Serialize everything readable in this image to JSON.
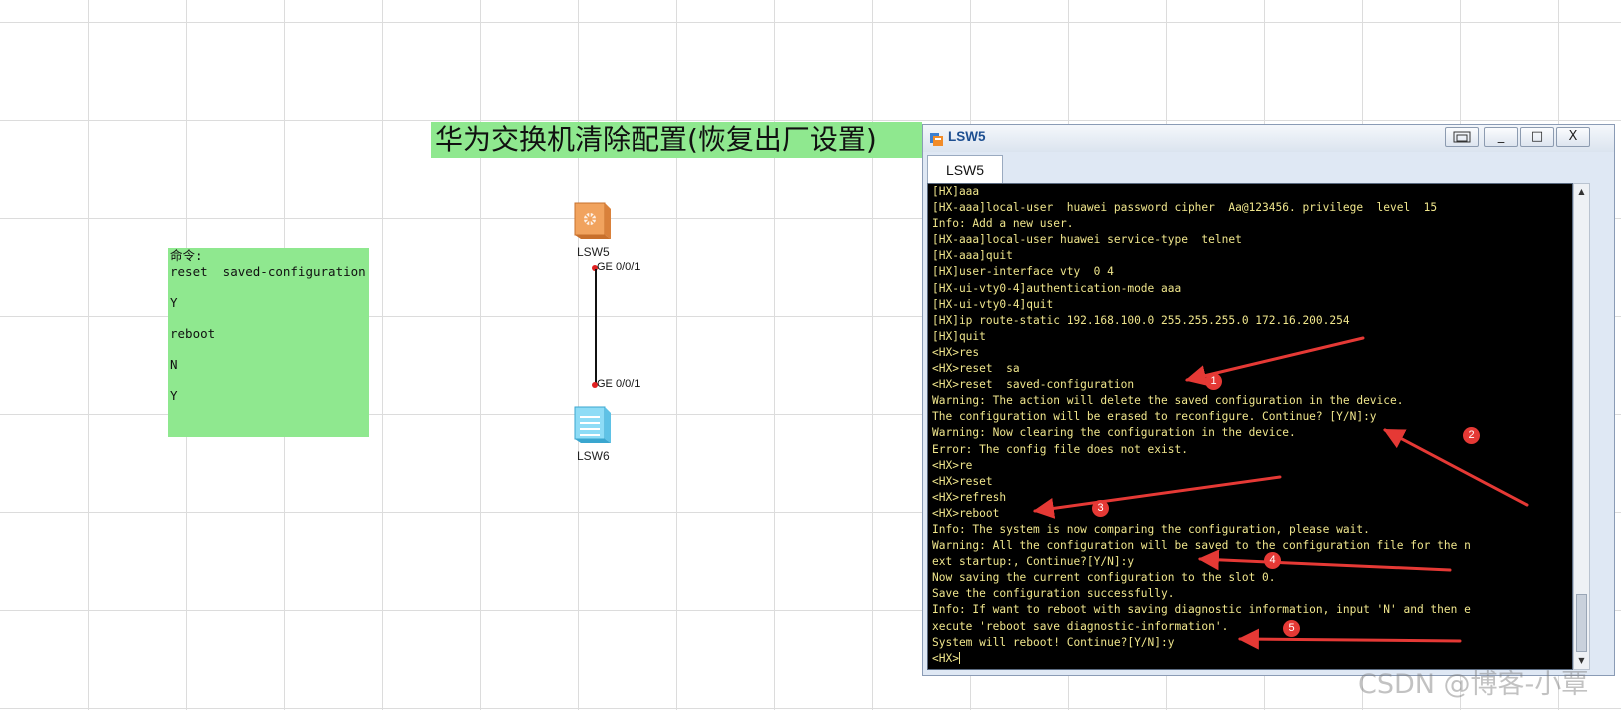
{
  "title_banner": "华为交换机清除配置(恢复出厂设置)",
  "notes": [
    "命令:",
    "reset  saved-configuration",
    "",
    "Y",
    "",
    "reboot",
    "",
    "N",
    "",
    "Y"
  ],
  "topology": {
    "device_top": {
      "label": "LSW5",
      "icon": "switch-orange-icon",
      "port": "GE 0/0/1"
    },
    "device_bottom": {
      "label": "LSW6",
      "icon": "switch-blue-icon",
      "port": "GE 0/0/1"
    }
  },
  "window": {
    "title": "LSW5",
    "tab_label": "LSW5",
    "buttons": {
      "restore": "restore-icon",
      "minimize": "_",
      "maximize": "□",
      "close": "X"
    }
  },
  "terminal": {
    "lines": [
      "[HX]aaa",
      "[HX-aaa]local-user  huawei password cipher  Aa@123456. privilege  level  15",
      "Info: Add a new user.",
      "[HX-aaa]local-user huawei service-type  telnet",
      "[HX-aaa]quit",
      "[HX]user-interface vty  0 4",
      "[HX-ui-vty0-4]authentication-mode aaa",
      "[HX-ui-vty0-4]quit",
      "[HX]ip route-static 192.168.100.0 255.255.255.0 172.16.200.254",
      "[HX]quit",
      "<HX>res",
      "<HX>reset  sa",
      "<HX>reset  saved-configuration",
      "Warning: The action will delete the saved configuration in the device.",
      "The configuration will be erased to reconfigure. Continue? [Y/N]:y",
      "Warning: Now clearing the configuration in the device.",
      "Error: The config file does not exist.",
      "<HX>re",
      "<HX>reset",
      "<HX>refresh",
      "<HX>reboot",
      "Info: The system is now comparing the configuration, please wait.",
      "Warning: All the configuration will be saved to the configuration file for the n",
      "ext startup:, Continue?[Y/N]:y",
      "Now saving the current configuration to the slot 0.",
      "Save the configuration successfully.",
      "Info: If want to reboot with saving diagnostic information, input 'N' and then e",
      "xecute 'reboot save diagnostic-information'.",
      "System will reboot! Continue?[Y/N]:y"
    ],
    "prompt": "<HX>"
  },
  "annotations": [
    "1",
    "2",
    "3",
    "4",
    "5"
  ],
  "colors": {
    "banner": "#8fe88f",
    "terminal_text": "#f0e68c",
    "arrow": "#e53935"
  },
  "watermark": "CSDN @博客-小覃"
}
